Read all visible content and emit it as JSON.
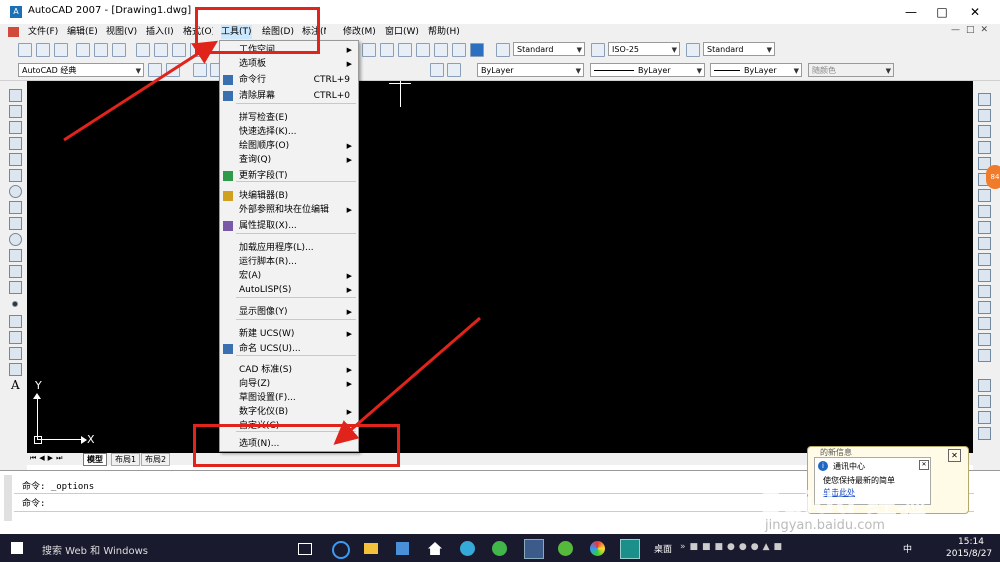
{
  "window": {
    "title": "AutoCAD 2007 - [Drawing1.dwg]"
  },
  "menubar": {
    "items": [
      {
        "label": "文件(F)"
      },
      {
        "label": "编辑(E)"
      },
      {
        "label": "视图(V)"
      },
      {
        "label": "插入(I)"
      },
      {
        "label": "格式(O)"
      },
      {
        "label": "工具(T)"
      },
      {
        "label": "绘图(D)"
      },
      {
        "label": "标注(N)"
      },
      {
        "label": "修改(M)"
      },
      {
        "label": "窗口(W)"
      },
      {
        "label": "帮助(H)"
      }
    ]
  },
  "toolbar": {
    "text_style": "Standard",
    "dim_style": "ISO-25",
    "table_style": "Standard",
    "workspace": "AutoCAD 经典",
    "layer": "ByLayer",
    "linetype": "ByLayer",
    "lineweight": "ByLayer",
    "plotstyle": "随颜色"
  },
  "tools_menu": {
    "items": [
      {
        "label": "工作空间",
        "shortcut": "",
        "submenu": true
      },
      {
        "label": "选项板",
        "shortcut": "",
        "submenu": true
      },
      {
        "label": "命令行",
        "shortcut": "CTRL+9",
        "submenu": false
      },
      {
        "label": "清除屏幕",
        "shortcut": "CTRL+0",
        "submenu": false
      },
      {
        "label": "拼写检查(E)",
        "shortcut": "",
        "submenu": false
      },
      {
        "label": "快速选择(K)...",
        "shortcut": "",
        "submenu": false
      },
      {
        "label": "绘图顺序(O)",
        "shortcut": "",
        "submenu": true
      },
      {
        "label": "查询(Q)",
        "shortcut": "",
        "submenu": true
      },
      {
        "label": "更新字段(T)",
        "shortcut": "",
        "submenu": false
      },
      {
        "label": "块编辑器(B)",
        "shortcut": "",
        "submenu": false
      },
      {
        "label": "外部参照和块在位编辑",
        "shortcut": "",
        "submenu": true
      },
      {
        "label": "属性提取(X)...",
        "shortcut": "",
        "submenu": false
      },
      {
        "label": "加载应用程序(L)...",
        "shortcut": "",
        "submenu": false
      },
      {
        "label": "运行脚本(R)...",
        "shortcut": "",
        "submenu": false
      },
      {
        "label": "宏(A)",
        "shortcut": "",
        "submenu": true
      },
      {
        "label": "AutoLISP(S)",
        "shortcut": "",
        "submenu": true
      },
      {
        "label": "显示图像(Y)",
        "shortcut": "",
        "submenu": true
      },
      {
        "label": "新建 UCS(W)",
        "shortcut": "",
        "submenu": true
      },
      {
        "label": "命名 UCS(U)...",
        "shortcut": "",
        "submenu": false
      },
      {
        "label": "CAD 标准(S)",
        "shortcut": "",
        "submenu": true
      },
      {
        "label": "向导(Z)",
        "shortcut": "",
        "submenu": true
      },
      {
        "label": "草图设置(F)...",
        "shortcut": "",
        "submenu": false
      },
      {
        "label": "数字化仪(B)",
        "shortcut": "",
        "submenu": true
      },
      {
        "label": "自定义(C)",
        "shortcut": "",
        "submenu": true
      },
      {
        "label": "选项(N)...",
        "shortcut": "",
        "submenu": false
      }
    ]
  },
  "canvas": {
    "ucs_x": "X",
    "ucs_y": "Y"
  },
  "tabs": [
    "模型",
    "布局1",
    "布局2"
  ],
  "command": {
    "line1": "命令: _options",
    "line2": "命令:"
  },
  "notification": {
    "header": "的新信息",
    "title": "通讯中心",
    "body": "使您保持最新的简单",
    "link": "单击此处"
  },
  "taskbar": {
    "search": "搜索 Web 和 Windows",
    "desktop": "桌面",
    "time": "15:14",
    "date": "2015/8/27",
    "ime": "中"
  },
  "watermark": {
    "brand": "Baidu 经验",
    "url": "jingyan.baidu.com"
  },
  "colors": {
    "annotation_red": "#e0241c",
    "canvas_bg": "#000000",
    "menu_highlight": "#cce8ff"
  }
}
